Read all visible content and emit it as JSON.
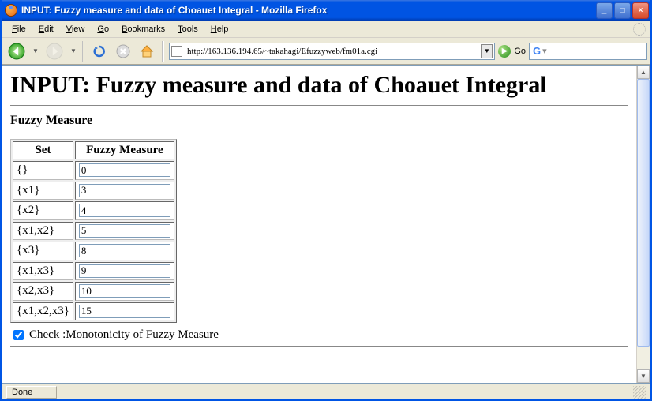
{
  "window": {
    "title": "INPUT: Fuzzy measure and data of Choauet Integral - Mozilla Firefox",
    "minimize": "_",
    "maximize": "□",
    "close": "×"
  },
  "menu": {
    "file": "File",
    "edit": "Edit",
    "view": "View",
    "go": "Go",
    "bookmarks": "Bookmarks",
    "tools": "Tools",
    "help": "Help"
  },
  "toolbar": {
    "go": "Go"
  },
  "url": "http://163.136.194.65/~takahagi/Efuzzyweb/fm01a.cgi",
  "page": {
    "heading": "INPUT: Fuzzy measure and data of Choauet Integral",
    "section": "Fuzzy Measure",
    "th_set": "Set",
    "th_fm": "Fuzzy Measure",
    "rows": [
      {
        "set": "{}",
        "val": "0"
      },
      {
        "set": "{x1}",
        "val": "3"
      },
      {
        "set": "{x2}",
        "val": "4"
      },
      {
        "set": "{x1,x2}",
        "val": "5"
      },
      {
        "set": "{x3}",
        "val": "8"
      },
      {
        "set": "{x1,x3}",
        "val": "9"
      },
      {
        "set": "{x2,x3}",
        "val": "10"
      },
      {
        "set": "{x1,x2,x3}",
        "val": "15"
      }
    ],
    "check_label": "Check :Monotonicity of Fuzzy Measure"
  },
  "status": {
    "text": "Done"
  }
}
